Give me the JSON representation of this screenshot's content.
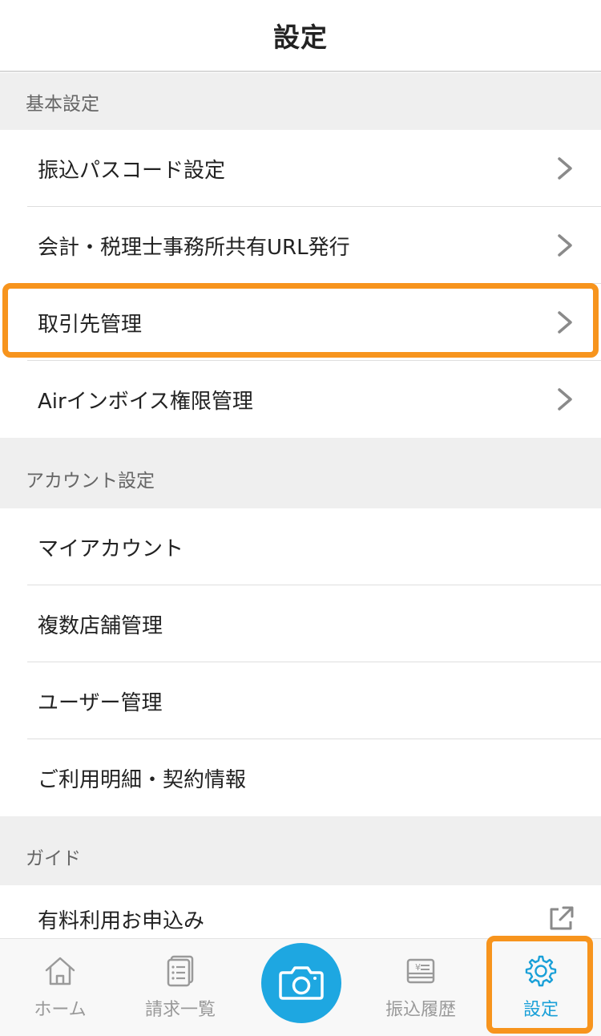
{
  "header": {
    "title": "設定"
  },
  "sections": {
    "basic": {
      "title": "基本設定",
      "items": [
        {
          "label": "振込パスコード設定"
        },
        {
          "label": "会計・税理士事務所共有URL発行"
        },
        {
          "label": "取引先管理"
        },
        {
          "label": "Airインボイス権限管理"
        }
      ]
    },
    "account": {
      "title": "アカウント設定",
      "items": [
        {
          "label": "マイアカウント"
        },
        {
          "label": "複数店舗管理"
        },
        {
          "label": "ユーザー管理"
        },
        {
          "label": "ご利用明細・契約情報"
        }
      ]
    },
    "guide": {
      "title": "ガイド",
      "items": [
        {
          "label": "有料利用お申込み"
        }
      ]
    }
  },
  "tabbar": {
    "tabs": [
      {
        "label": "ホーム",
        "icon": "home-icon"
      },
      {
        "label": "請求一覧",
        "icon": "invoice-list-icon"
      },
      {
        "label": "",
        "icon": "camera-icon"
      },
      {
        "label": "振込履歴",
        "icon": "transfer-history-icon"
      },
      {
        "label": "設定",
        "icon": "gear-icon"
      }
    ],
    "active_tab": "設定"
  },
  "colors": {
    "accent": "#1ea7e1",
    "active_tab_text": "#1aa0d8",
    "highlight": "#f7941d",
    "section_bg": "#efefef"
  }
}
